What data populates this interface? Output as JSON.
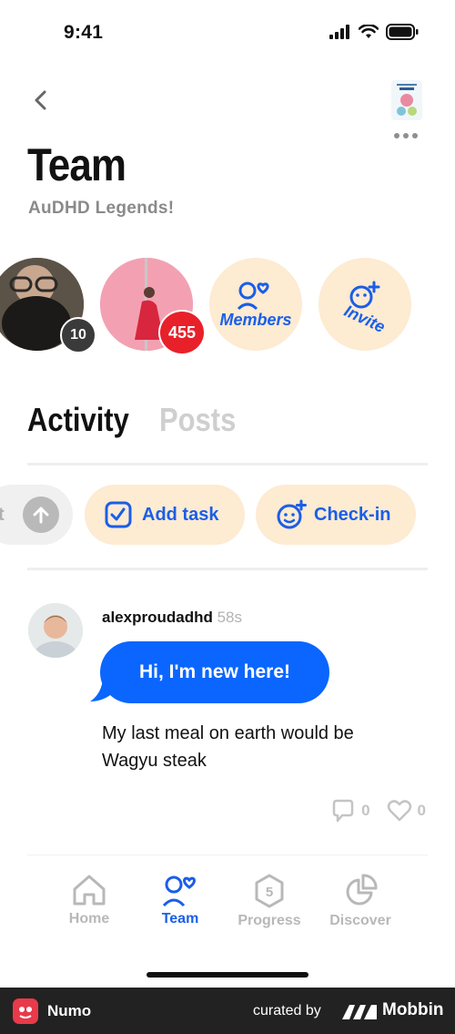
{
  "status_bar": {
    "time": "9:41"
  },
  "header": {
    "title": "Team",
    "subtitle": "AuDHD Legends!"
  },
  "members": [
    {
      "name": "member-1",
      "streak": "10"
    },
    {
      "name": "member-2",
      "streak": "455"
    }
  ],
  "quick_actions": {
    "members_label": "Members",
    "invite_label": "Invite"
  },
  "tabs": [
    {
      "label": "Activity",
      "active": true
    },
    {
      "label": "Posts",
      "active": false
    }
  ],
  "actions": [
    {
      "label": "t",
      "icon": "arrow-up-icon"
    },
    {
      "label": "Add task",
      "icon": "checkbox-icon"
    },
    {
      "label": "Check-in",
      "icon": "smiley-plus-icon"
    }
  ],
  "post": {
    "username": "alexproudadhd",
    "time": "58s",
    "bubble": "Hi, I'm new here!",
    "message": "My last meal on earth would be Wagyu steak",
    "comments": "0",
    "likes": "0"
  },
  "bottom_nav": [
    {
      "label": "Home",
      "icon": "house-icon",
      "active": false
    },
    {
      "label": "Team",
      "icon": "team-icon",
      "active": true
    },
    {
      "label": "Progress",
      "icon": "progress-icon",
      "badge": "5",
      "active": false
    },
    {
      "label": "Discover",
      "icon": "discover-icon",
      "active": false
    }
  ],
  "footer": {
    "app_name": "Numo",
    "curated_by": "curated by",
    "brand": "Mobbin"
  },
  "colors": {
    "accent": "#1a5ee8",
    "bubble": "#0a66ff",
    "pill_bg": "#fdebd2",
    "badge_red": "#e8202a",
    "badge_dark": "#3a3a3a"
  }
}
